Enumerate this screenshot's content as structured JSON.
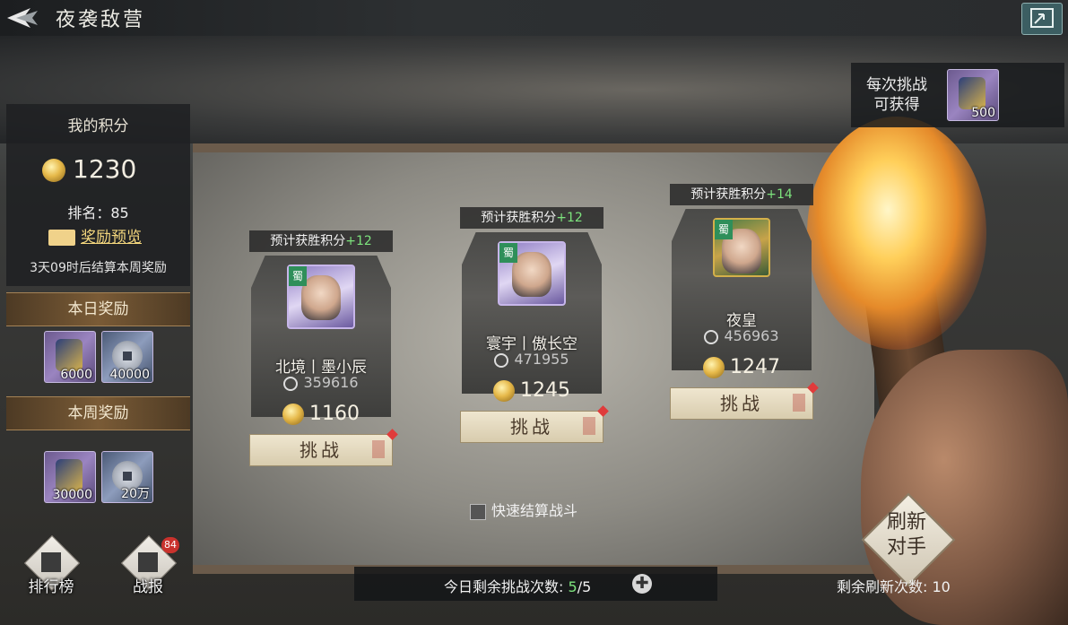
{
  "header": {
    "title": "夜袭敌营"
  },
  "my_panel": {
    "title": "我的积分",
    "points": "1230",
    "rank": "排名：85",
    "reward_preview": "奖励预览",
    "settle_text": "3天09时后结算本周奖励"
  },
  "daily_rewards": {
    "title": "本日奖励",
    "items": [
      {
        "icon": "medal-icon",
        "count": "6000"
      },
      {
        "icon": "coin-cash-icon",
        "count": "40000"
      }
    ]
  },
  "weekly_rewards": {
    "title": "本周奖励",
    "items": [
      {
        "icon": "medal-icon",
        "count": "30000"
      },
      {
        "icon": "coin-cash-icon",
        "count": "20万"
      }
    ]
  },
  "per_challenge": {
    "label_line1": "每次挑战",
    "label_line2": "可获得",
    "count": "500"
  },
  "opponents": [
    {
      "predict_label": "预计获胜积分",
      "predict_plus": "+12",
      "name": "北境丨墨小辰",
      "power": "359616",
      "points": "1160",
      "challenge_label": "挑战",
      "faction": "蜀"
    },
    {
      "predict_label": "预计获胜积分",
      "predict_plus": "+12",
      "name": "寰宇丨傲长空",
      "power": "471955",
      "points": "1245",
      "challenge_label": "挑战",
      "faction": "蜀"
    },
    {
      "predict_label": "预计获胜积分",
      "predict_plus": "+14",
      "name": "夜皇",
      "power": "456963",
      "points": "1247",
      "challenge_label": "挑战",
      "faction": "蜀"
    }
  ],
  "quick_settle": {
    "label": "快速结算战斗"
  },
  "bottom_bar": {
    "label": "今日剩余挑战次数:",
    "remaining": "5",
    "total": "/5"
  },
  "refresh": {
    "line1": "刷新",
    "line2": "对手",
    "remaining_label": "剩余刷新次数: 10"
  },
  "nav": {
    "leaderboard": "排行榜",
    "battle_report": "战报",
    "battle_report_badge": "84"
  },
  "colors": {
    "accent_green": "#7de37d",
    "badge_red": "#c9322d",
    "gold": "#f4d77d"
  }
}
